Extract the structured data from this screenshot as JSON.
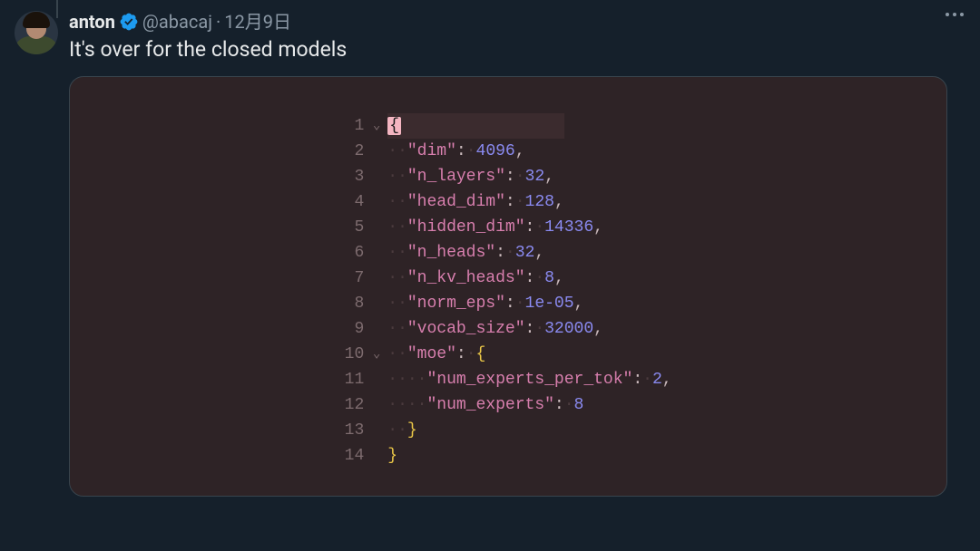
{
  "tweet": {
    "display_name": "anton",
    "handle": "@abacaj",
    "separator": "·",
    "date": "12月9日",
    "text": "It's over for the closed models"
  },
  "code": {
    "lines": [
      {
        "n": "1",
        "fold": true,
        "tokens": [
          {
            "t": "brace_hl",
            "v": "{"
          }
        ],
        "hl": true
      },
      {
        "n": "2",
        "fold": false,
        "indent": 1,
        "key": "dim",
        "value": "4096",
        "comma": true
      },
      {
        "n": "3",
        "fold": false,
        "indent": 1,
        "key": "n_layers",
        "value": "32",
        "comma": true
      },
      {
        "n": "4",
        "fold": false,
        "indent": 1,
        "key": "head_dim",
        "value": "128",
        "comma": true
      },
      {
        "n": "5",
        "fold": false,
        "indent": 1,
        "key": "hidden_dim",
        "value": "14336",
        "comma": true
      },
      {
        "n": "6",
        "fold": false,
        "indent": 1,
        "key": "n_heads",
        "value": "32",
        "comma": true
      },
      {
        "n": "7",
        "fold": false,
        "indent": 1,
        "key": "n_kv_heads",
        "value": "8",
        "comma": true
      },
      {
        "n": "8",
        "fold": false,
        "indent": 1,
        "key": "norm_eps",
        "value": "1e-05",
        "comma": true
      },
      {
        "n": "9",
        "fold": false,
        "indent": 1,
        "key": "vocab_size",
        "value": "32000",
        "comma": true
      },
      {
        "n": "10",
        "fold": true,
        "indent": 1,
        "key": "moe",
        "open_brace": true
      },
      {
        "n": "11",
        "fold": false,
        "indent": 2,
        "key": "num_experts_per_tok",
        "value": "2",
        "comma": true
      },
      {
        "n": "12",
        "fold": false,
        "indent": 2,
        "key": "num_experts",
        "value": "8",
        "comma": false
      },
      {
        "n": "13",
        "fold": false,
        "indent": 1,
        "close_brace": true
      },
      {
        "n": "14",
        "fold": false,
        "tokens": [
          {
            "t": "brace",
            "v": "}"
          }
        ]
      }
    ]
  }
}
